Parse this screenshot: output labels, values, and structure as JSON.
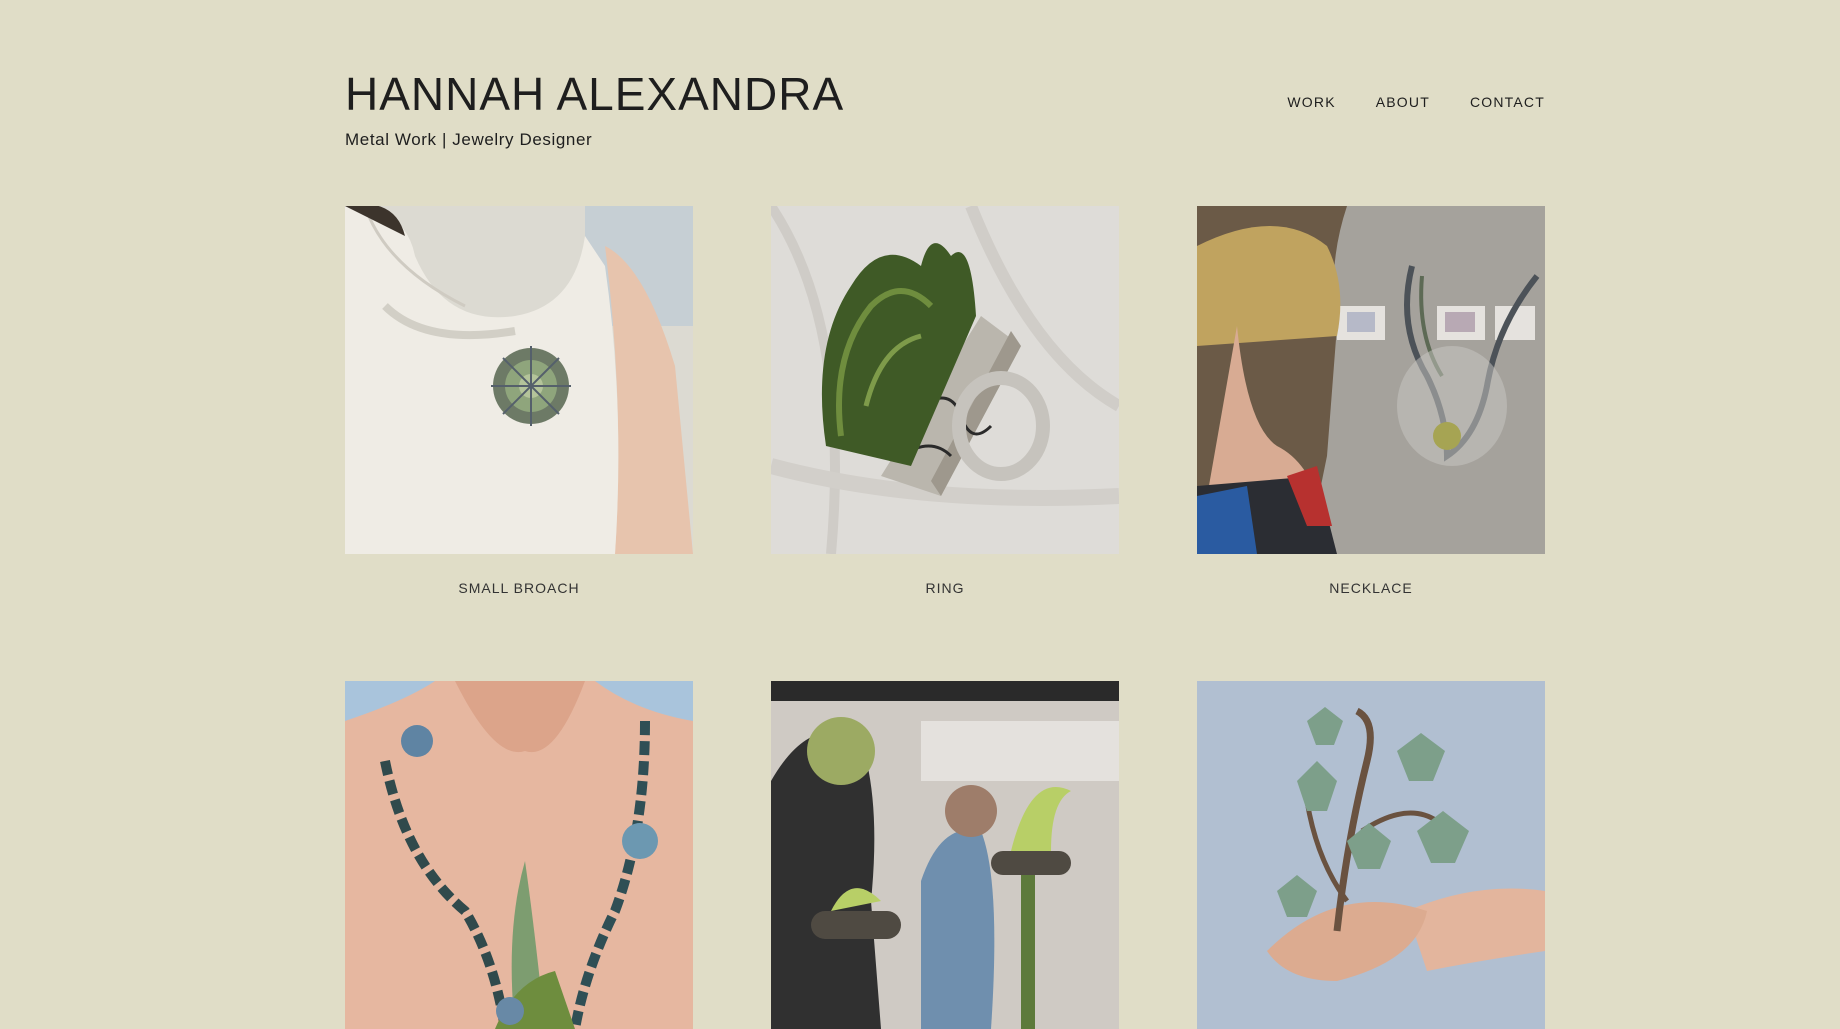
{
  "site": {
    "title": "HANNAH ALEXANDRA",
    "tagline": "Metal Work | Jewelry Designer"
  },
  "nav": [
    "WORK",
    "ABOUT",
    "CONTACT"
  ],
  "works": [
    {
      "caption": "SMALL BROACH"
    },
    {
      "caption": "RING"
    },
    {
      "caption": "NECKLACE"
    },
    {
      "caption": ""
    },
    {
      "caption": ""
    },
    {
      "caption": ""
    }
  ],
  "colors": {
    "background": "#e0ddc7",
    "text": "#1e1e1e"
  }
}
